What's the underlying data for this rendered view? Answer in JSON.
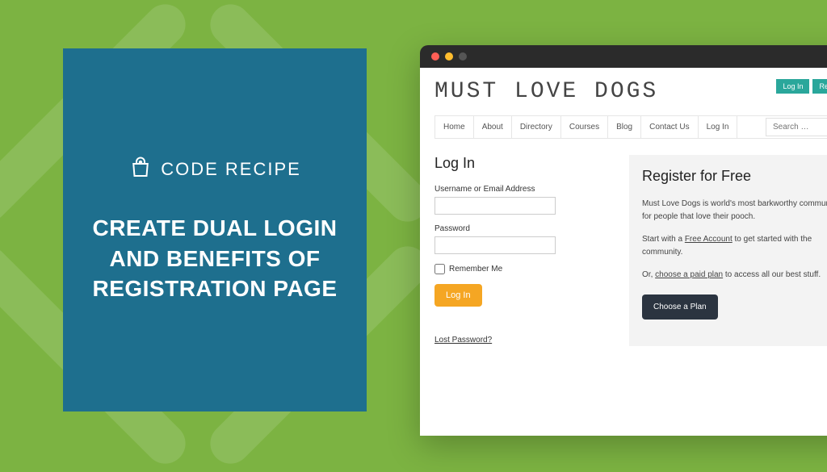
{
  "brand": {
    "label": "CODE RECIPE"
  },
  "headline_lines": [
    "CREATE DUAL LOGIN",
    "AND BENEFITS OF",
    "REGISTRATION PAGE"
  ],
  "site": {
    "title": "MUST LOVE DOGS"
  },
  "top_buttons": {
    "login": "Log In",
    "register": "Register"
  },
  "nav": {
    "items": [
      "Home",
      "About",
      "Directory",
      "Courses",
      "Blog",
      "Contact Us",
      "Log In"
    ]
  },
  "search": {
    "placeholder": "Search …"
  },
  "login": {
    "heading": "Log In",
    "username_label": "Username or Email Address",
    "password_label": "Password",
    "remember_label": "Remember Me",
    "button": "Log In",
    "lost_password": "Lost Password?"
  },
  "register": {
    "heading": "Register for Free",
    "p1_a": "Must Love Dogs is world's most barkworthy community for people that love their pooch.",
    "p2_a": "Start with a ",
    "p2_link": "Free Account",
    "p2_b": " to get started with the community.",
    "p3_a": "Or, ",
    "p3_link": "choose a paid plan",
    "p3_b": " to access all our best stuff.",
    "button": "Choose a Plan"
  }
}
